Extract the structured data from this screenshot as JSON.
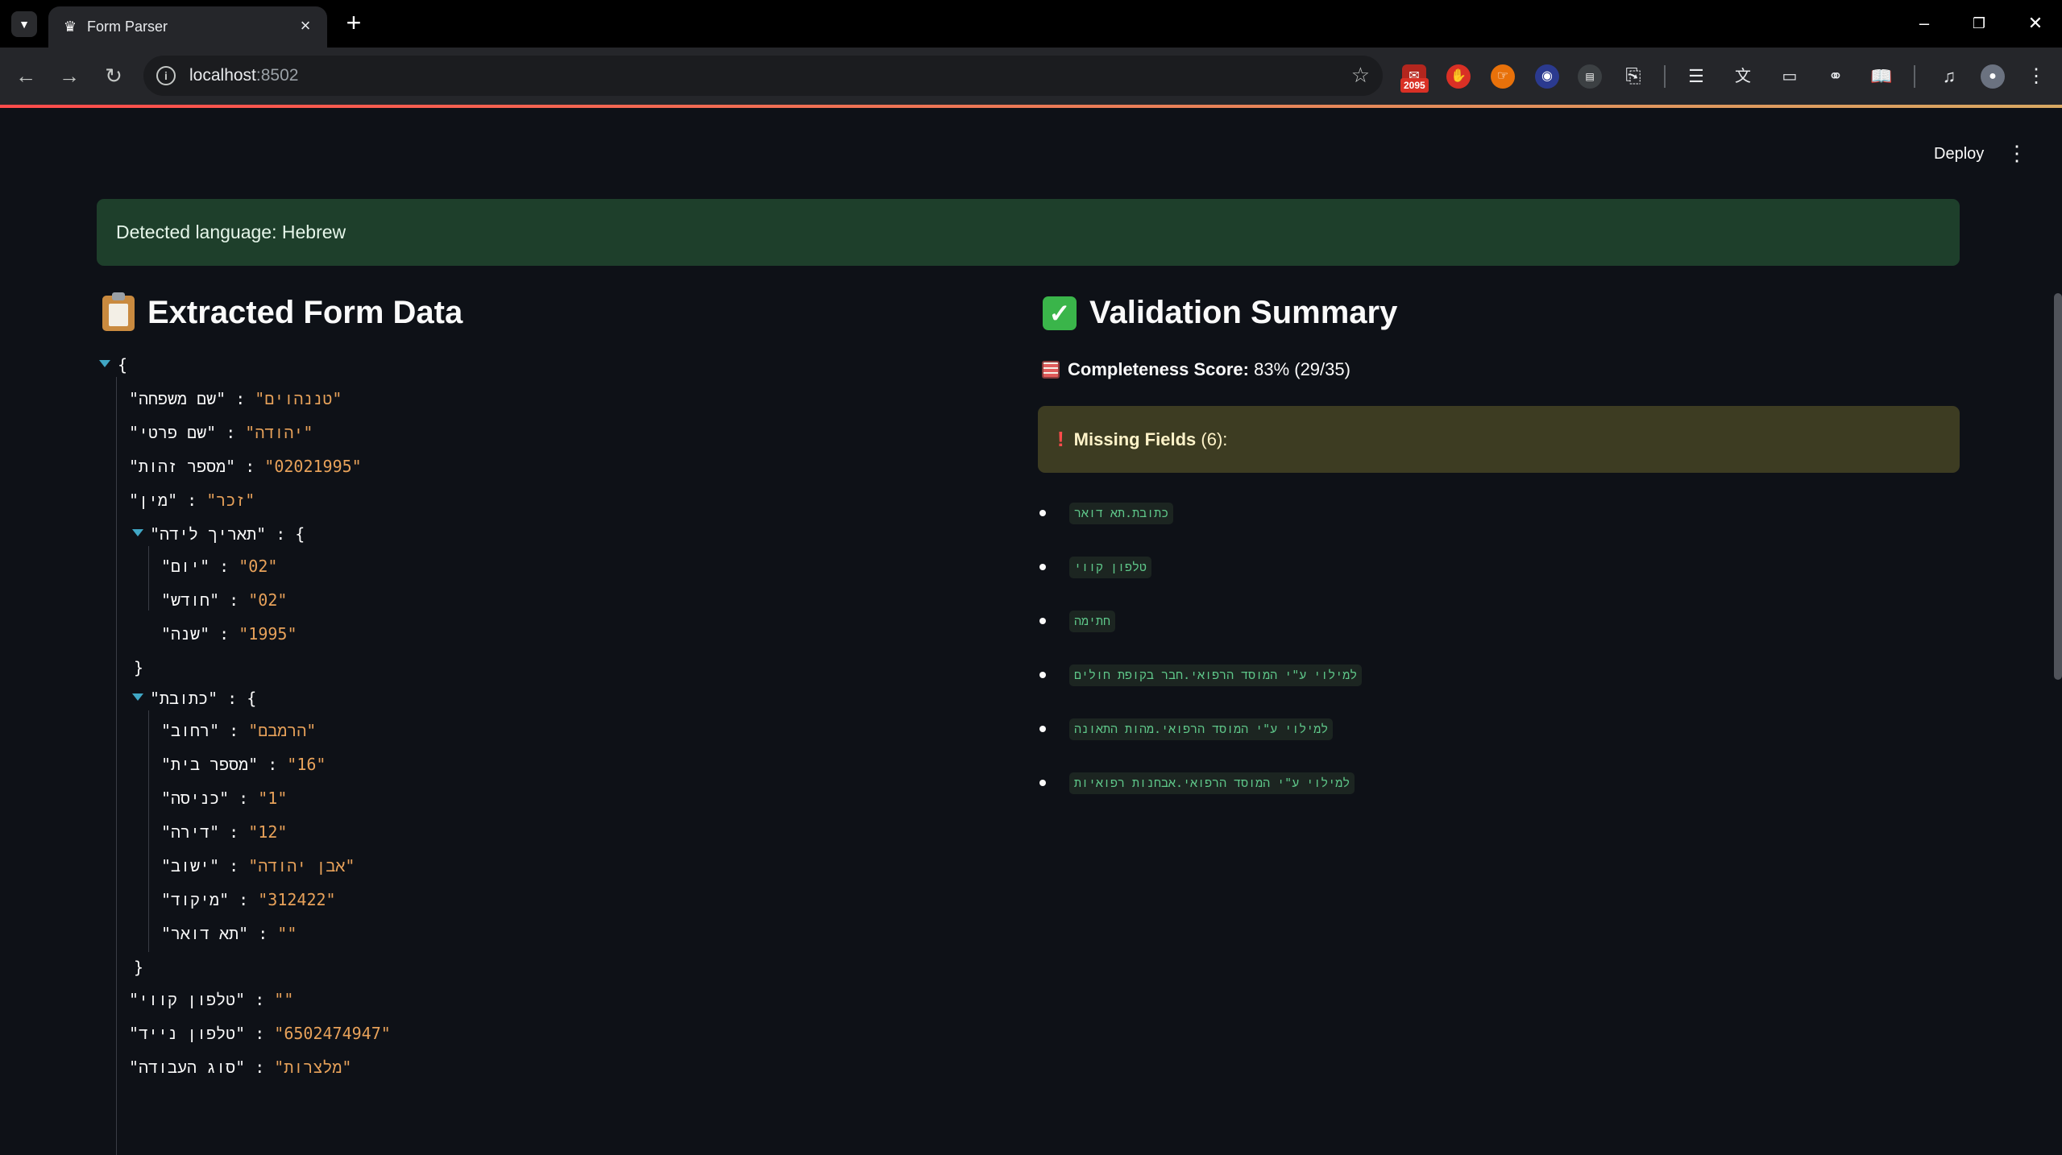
{
  "browser": {
    "tab_title": "Form Parser",
    "url_host": "localhost",
    "url_port": ":8502",
    "extension_badge": "2095"
  },
  "app": {
    "deploy_label": "Deploy",
    "language_alert": "Detected language: Hebrew",
    "left_header": "Extracted Form Data",
    "right_header": "Validation Summary",
    "score_label": "Completeness Score:",
    "score_value": "83% (29/35)",
    "missing_label": "Missing Fields",
    "missing_count": "(6):"
  },
  "form_json": {
    "open_brace": "{",
    "close_brace": "}",
    "last_name_key": "\"שם משפחה\"",
    "last_name_val": "\"טננהוים\"",
    "first_name_key": "\"שם פרטי\"",
    "first_name_val": "\"יהודה\"",
    "id_key": "\"מספר זהות\"",
    "id_val": "\"02021995\"",
    "gender_key": "\"מין\"",
    "gender_val": "\"זכר\"",
    "birth_key": "\"תאריך לידה\"",
    "day_key": "\"יום\"",
    "day_val": "\"02\"",
    "month_key": "\"חודש\"",
    "month_val": "\"02\"",
    "year_key": "\"שנה\"",
    "year_val": "\"1995\"",
    "address_key": "\"כתובת\"",
    "street_key": "\"רחוב\"",
    "street_val": "\"הרמבם\"",
    "house_key": "\"מספר בית\"",
    "house_val": "\"16\"",
    "entrance_key": "\"כניסה\"",
    "entrance_val": "\"1\"",
    "apt_key": "\"דירה\"",
    "apt_val": "\"12\"",
    "city_key": "\"ישוב\"",
    "city_val": "\"אבן יהודה\"",
    "zip_key": "\"מיקוד\"",
    "zip_val": "\"312422\"",
    "pobox_key": "\"תא דואר\"",
    "pobox_val": "\"\"",
    "landline_key": "\"טלפון קווי\"",
    "landline_val": "\"\"",
    "mobile_key": "\"טלפון נייד\"",
    "mobile_val": "\"6502474947\"",
    "worktype_key": "\"סוג העבודה\"",
    "worktype_val": "\"מלצרות\""
  },
  "missing_fields": [
    "כתובת.תא דואר",
    "טלפון קווי",
    "חתימה",
    "למילוי ע\"י המוסד הרפואי.חבר בקופת חולים",
    "למילוי ע\"י המוסד הרפואי.מהות התאונה",
    "למילוי ע\"י המוסד הרפואי.אבחנות רפואיות"
  ]
}
